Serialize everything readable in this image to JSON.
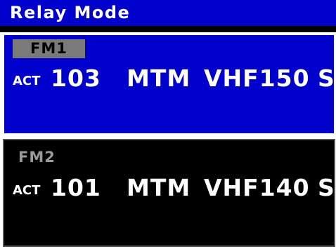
{
  "header": {
    "title": "Relay Mode"
  },
  "panels": [
    {
      "channel_tag": "FM1",
      "state": "ACT",
      "channel_number": "103",
      "mode": "MTM",
      "band": "VHF150",
      "flag": "S",
      "selected": true
    },
    {
      "channel_tag": "FM2",
      "state": "ACT",
      "channel_number": "101",
      "mode": "MTM",
      "band": "VHF140",
      "flag": "S",
      "selected": false
    }
  ],
  "colors": {
    "title_bar": "#0000cc",
    "selected_panel": "#0000cc",
    "unselected_panel": "#000000",
    "text": "#ffffff",
    "tag_highlight": "#7a7a7a"
  }
}
